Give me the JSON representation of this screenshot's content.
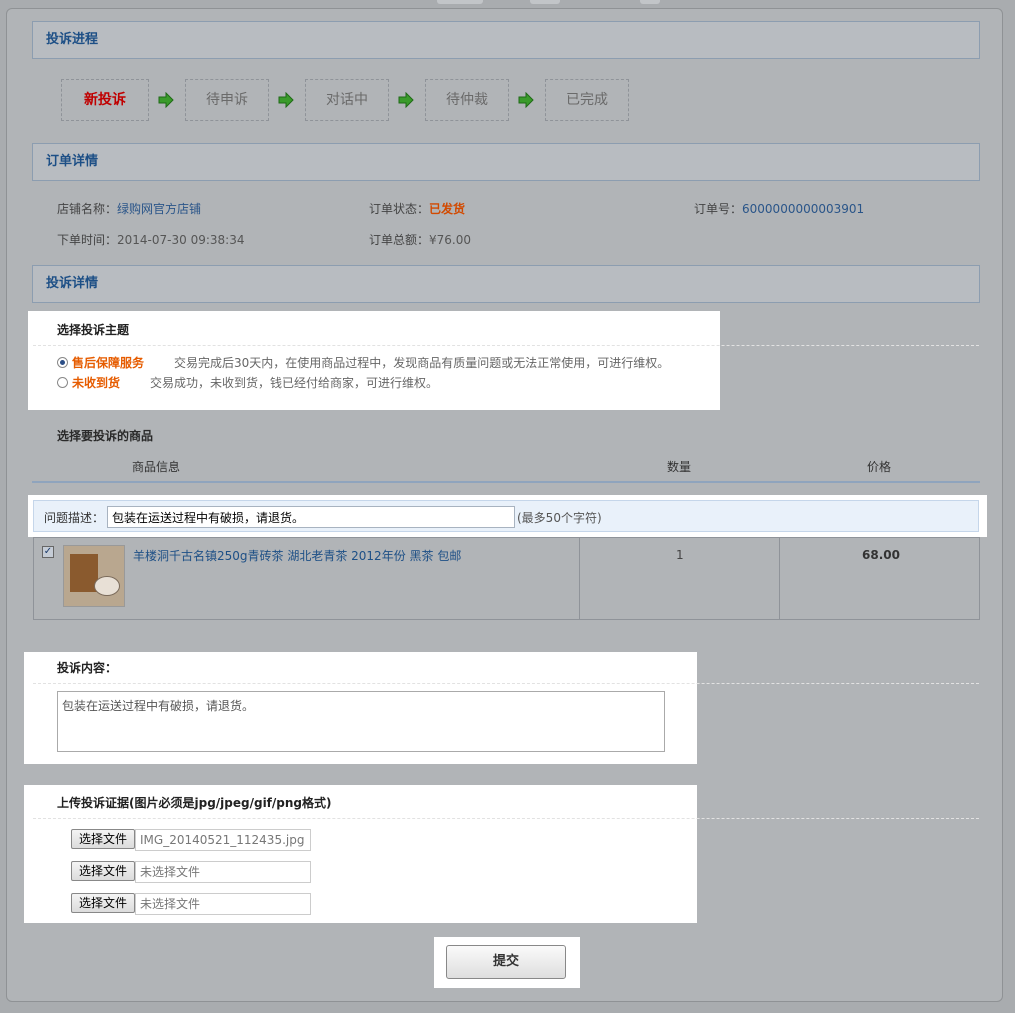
{
  "sections": {
    "progress_title": "投诉进程",
    "order_title": "订单详情",
    "complaint_title": "投诉详情"
  },
  "steps": [
    "新投诉",
    "待申诉",
    "对话中",
    "待仲裁",
    "已完成"
  ],
  "order": {
    "store_label": "店铺名称：",
    "store_value": "绿购网官方店铺",
    "status_label": "订单状态：",
    "status_value": "已发货",
    "number_label": "订单号：",
    "number_value": "6000000000003901",
    "time_label": "下单时间：",
    "time_value": "2014-07-30 09:38:34",
    "total_label": "订单总额：",
    "total_value": "¥76.00"
  },
  "subject": {
    "title": "选择投诉主题",
    "options": [
      {
        "label": "售后保障服务",
        "desc": "交易完成后30天内，在使用商品过程中，发现商品有质量问题或无法正常使用，可进行维权。",
        "selected": true
      },
      {
        "label": "未收到货",
        "desc": "交易成功，未收到货，钱已经付给商家，可进行维权。",
        "selected": false
      }
    ]
  },
  "goods": {
    "title": "选择要投诉的商品",
    "col_info": "商品信息",
    "col_qty": "数量",
    "col_price": "价格",
    "desc_label": "问题描述：",
    "desc_value": "包装在运送过程中有破损，请退货。",
    "desc_hint": "(最多50个字符)",
    "item": {
      "name": "羊楼洞千古名镇250g青砖茶 湖北老青茶 2012年份 黑茶 包邮",
      "qty": "1",
      "price": "68.00",
      "checked": true
    }
  },
  "content": {
    "title": "投诉内容：",
    "value": "包装在运送过程中有破损，请退货。"
  },
  "upload": {
    "title": "上传投诉证据(图片必须是jpg/jpeg/gif/png格式)",
    "button_label": "选择文件",
    "files": [
      "IMG_20140521_112435.jpg",
      "未选择文件",
      "未选择文件"
    ]
  },
  "submit_label": "提交",
  "colors": {
    "accent": "#1d4f86",
    "highlight": "#e65c00",
    "active_step": "#c00000"
  }
}
